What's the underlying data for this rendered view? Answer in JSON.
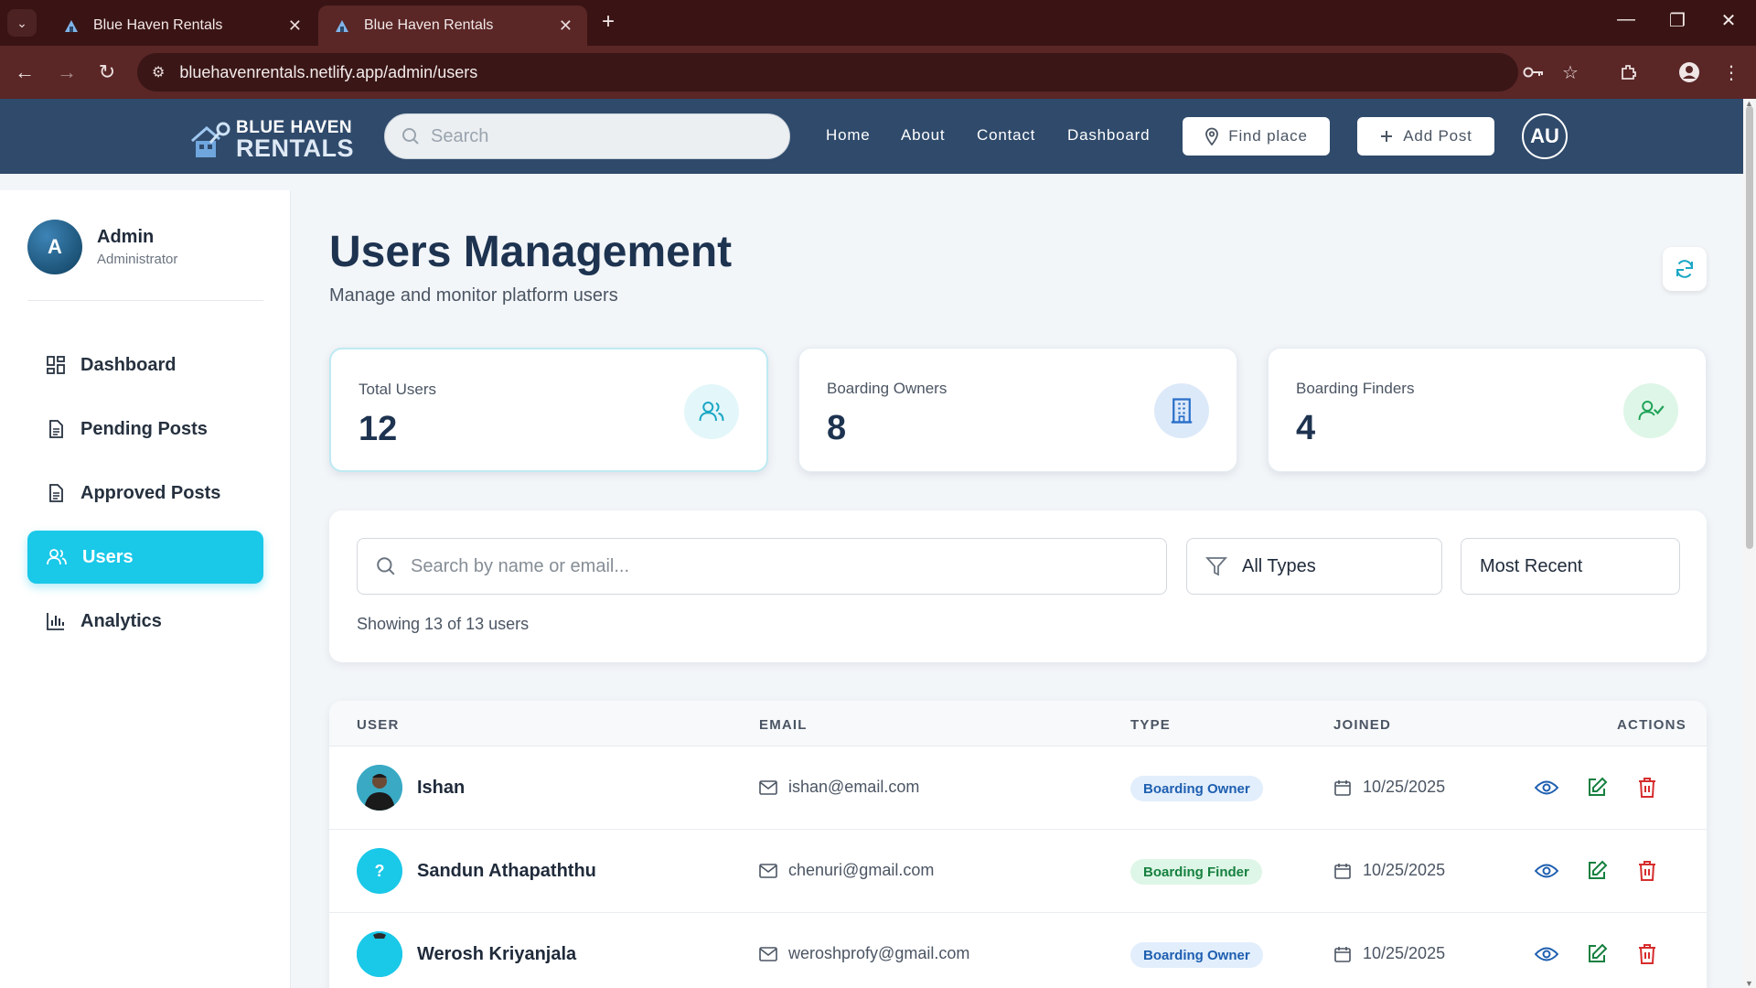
{
  "browser": {
    "tabs": [
      {
        "title": "Blue Haven Rentals",
        "active": false
      },
      {
        "title": "Blue Haven Rentals",
        "active": true
      }
    ],
    "url": "bluehavenrentals.netlify.app/admin/users"
  },
  "header": {
    "logo_line1": "BLUE HAVEN",
    "logo_line2": "RENTALS",
    "search_placeholder": "Search",
    "nav": [
      "Home",
      "About",
      "Contact",
      "Dashboard"
    ],
    "find_place": "Find place",
    "add_post": "Add Post",
    "avatar_initials": "AU"
  },
  "sidebar": {
    "avatar_letter": "A",
    "name": "Admin",
    "role": "Administrator",
    "items": [
      {
        "label": "Dashboard",
        "icon": "grid-icon",
        "active": false
      },
      {
        "label": "Pending Posts",
        "icon": "document-icon",
        "active": false
      },
      {
        "label": "Approved Posts",
        "icon": "document-icon",
        "active": false
      },
      {
        "label": "Users",
        "icon": "users-icon",
        "active": true
      },
      {
        "label": "Analytics",
        "icon": "bar-chart-icon",
        "active": false
      }
    ]
  },
  "main": {
    "title": "Users Management",
    "subtitle": "Manage and monitor platform users",
    "stats": [
      {
        "label": "Total Users",
        "value": "12",
        "icon": "users-icon",
        "color": "#1aa7c4"
      },
      {
        "label": "Boarding Owners",
        "value": "8",
        "icon": "building-icon",
        "color": "#2a6fc9"
      },
      {
        "label": "Boarding Finders",
        "value": "4",
        "icon": "user-check-icon",
        "color": "#22a35a"
      }
    ],
    "filters": {
      "search_placeholder": "Search by name or email...",
      "type_value": "All Types",
      "sort_value": "Most Recent",
      "count_text": "Showing 13 of 13 users"
    },
    "table": {
      "headers": [
        "USER",
        "EMAIL",
        "TYPE",
        "JOINED",
        "ACTIONS"
      ],
      "rows": [
        {
          "avatar": "",
          "name": "Ishan",
          "email": "ishan@email.com",
          "type": "Boarding Owner",
          "joined": "10/25/2025"
        },
        {
          "avatar": "?",
          "name": "Sandun Athapaththu",
          "email": "chenuri@gmail.com",
          "type": "Boarding Finder",
          "joined": "10/25/2025"
        },
        {
          "avatar": "",
          "name": "Werosh Kriyanjala",
          "email": "weroshprofy@gmail.com",
          "type": "Boarding Owner",
          "joined": "10/25/2025"
        }
      ]
    }
  },
  "colors": {
    "accent": "#1ac8e8",
    "header_bg": "#2f4a6b",
    "browser_bg": "#5a2626"
  }
}
